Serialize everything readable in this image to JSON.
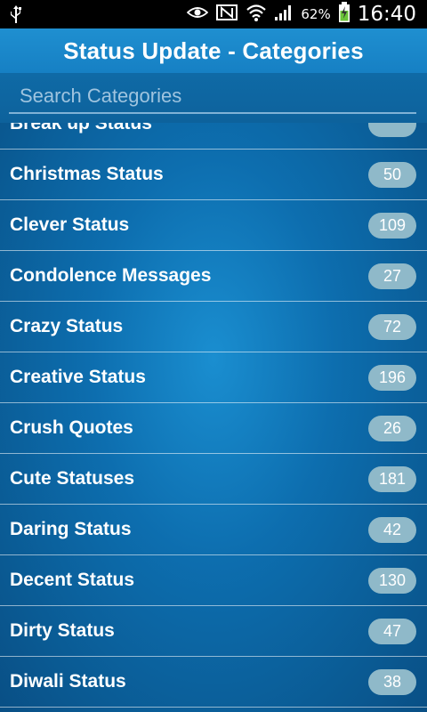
{
  "status_bar": {
    "battery_percent": "62%",
    "time": "16:40",
    "icons": [
      "usb-icon",
      "eye-icon",
      "nfc-icon",
      "wifi-icon",
      "signal-icon",
      "battery-charging-icon"
    ]
  },
  "header": {
    "title": "Status Update - Categories"
  },
  "search": {
    "placeholder": "Search Categories",
    "value": ""
  },
  "categories": [
    {
      "label": "Break up Status",
      "count": ""
    },
    {
      "label": "Christmas Status",
      "count": "50"
    },
    {
      "label": "Clever Status",
      "count": "109"
    },
    {
      "label": "Condolence Messages",
      "count": "27"
    },
    {
      "label": "Crazy Status",
      "count": "72"
    },
    {
      "label": "Creative Status",
      "count": "196"
    },
    {
      "label": "Crush Quotes",
      "count": "26"
    },
    {
      "label": "Cute Statuses",
      "count": "181"
    },
    {
      "label": "Daring Status",
      "count": "42"
    },
    {
      "label": "Decent Status",
      "count": "130"
    },
    {
      "label": "Dirty Status",
      "count": "47"
    },
    {
      "label": "Diwali Status",
      "count": "38"
    }
  ],
  "colors": {
    "action_bar": "#1f8fd0",
    "badge": "#8fb9c9",
    "list_background": "#0d6eaf"
  }
}
